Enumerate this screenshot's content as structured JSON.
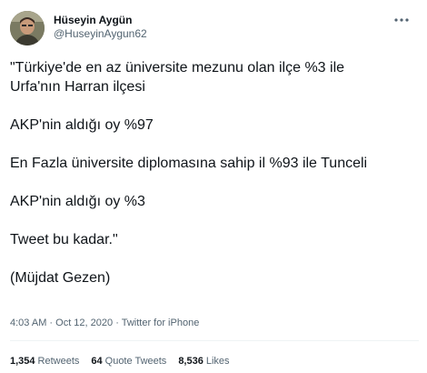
{
  "user": {
    "display_name": "Hüseyin Aygün",
    "handle": "@HuseyinAygun62"
  },
  "tweet": {
    "text": "\"Türkiye'de en az üniversite mezunu olan ilçe %3 ile\nUrfa'nın Harran ilçesi\n\nAKP'nin aldığı oy %97\n\nEn Fazla üniversite diplomasına sahip il %93 ile Tunceli\n\nAKP'nin aldığı oy %3\n\nTweet bu kadar.\"\n\n(Müjdat Gezen)"
  },
  "meta": {
    "time": "4:03 AM",
    "separator1": " · ",
    "date": "Oct 12, 2020",
    "separator2": " · ",
    "source": "Twitter for iPhone"
  },
  "stats": {
    "retweets_count": "1,354",
    "retweets_label": "Retweets",
    "quote_count": "64",
    "quote_label": "Quote Tweets",
    "likes_count": "8,536",
    "likes_label": "Likes"
  },
  "icons": {
    "more": "more-horizontal-icon",
    "avatar": "avatar-photo"
  },
  "colors": {
    "text_primary": "#0f1419",
    "text_secondary": "#536471",
    "divider": "#eff3f4"
  }
}
